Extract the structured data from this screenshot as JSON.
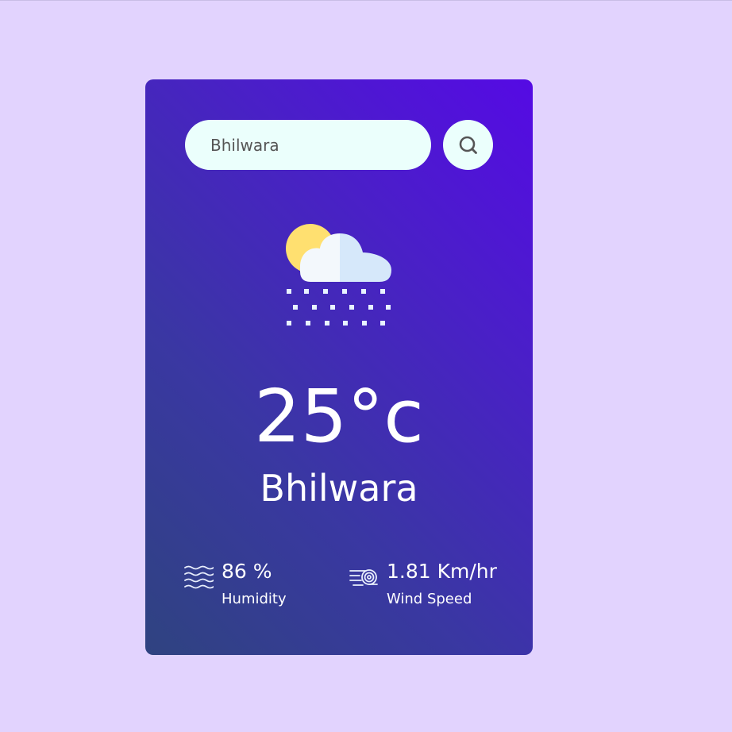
{
  "search": {
    "value": "Bhilwara",
    "icon": "search-icon"
  },
  "weather": {
    "icon": "sun-cloud-snow-icon",
    "temperature": "25°c",
    "city": "Bhilwara"
  },
  "humidity": {
    "icon": "humidity-waves-icon",
    "value": "86 %",
    "label": "Humidity"
  },
  "wind": {
    "icon": "wind-icon",
    "value": "1.81 Km/hr",
    "label": "Wind Speed"
  },
  "colors": {
    "background": "#e2d3fe",
    "card_gradient_start": "#2f4380",
    "card_gradient_end": "#550ae4",
    "input_bg": "#ebfffc",
    "text": "#ffffff"
  }
}
